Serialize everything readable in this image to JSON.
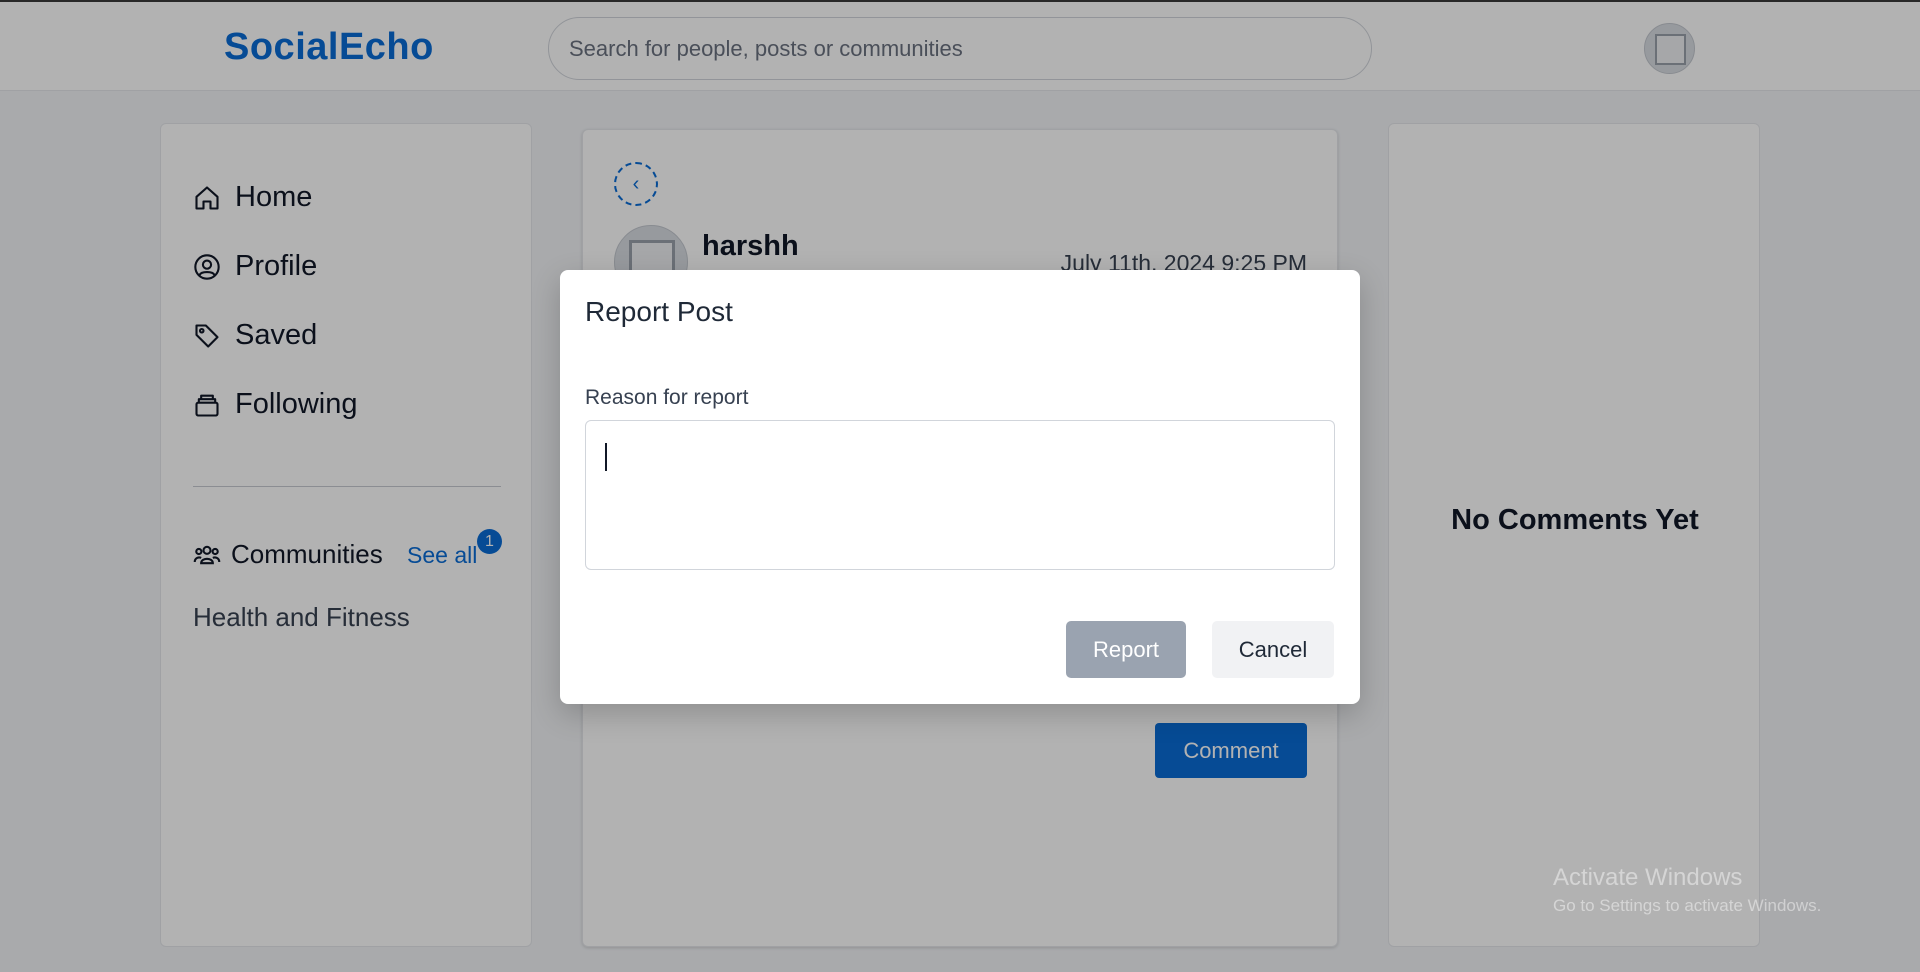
{
  "header": {
    "brand": "SocialEcho",
    "search_placeholder": "Search for people, posts or communities"
  },
  "sidebar": {
    "items": [
      {
        "label": "Home",
        "icon": "home-icon"
      },
      {
        "label": "Profile",
        "icon": "user-circle-icon"
      },
      {
        "label": "Saved",
        "icon": "tag-icon"
      },
      {
        "label": "Following",
        "icon": "stack-icon"
      }
    ],
    "communities_label": "Communities",
    "see_all_label": "See all",
    "see_all_badge": "1",
    "communities": [
      "Health and Fitness"
    ]
  },
  "post": {
    "back_icon": "chevron-left-icon",
    "username": "harshh",
    "timestamp": "July 11th, 2024 9:25 PM",
    "comment_button": "Comment"
  },
  "comments": {
    "empty_text": "No Comments Yet"
  },
  "modal": {
    "title": "Report Post",
    "field_label": "Reason for report",
    "field_value": "",
    "report_button": "Report",
    "cancel_button": "Cancel"
  },
  "watermark": {
    "line1": "Activate Windows",
    "line2": "Go to Settings to activate Windows."
  },
  "colors": {
    "accent": "#0a6cd6",
    "overlay": "rgba(0,0,0,0.30)",
    "report_disabled": "#9aa3b0"
  }
}
